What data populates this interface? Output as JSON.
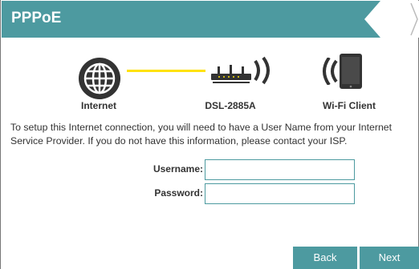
{
  "header": {
    "title": "PPPoE"
  },
  "diagram": {
    "internet_label": "Internet",
    "router_label": "DSL-2885A",
    "client_label": "Wi-Fi Client",
    "line_color": "#ffe20a"
  },
  "description": "To setup this Internet connection, you will need to have a User Name from your Internet Service Provider. If you do not have this information, please contact your ISP.",
  "form": {
    "username_label": "Username:",
    "username_value": "",
    "password_label": "Password:",
    "password_value": ""
  },
  "buttons": {
    "back": "Back",
    "next": "Next"
  },
  "colors": {
    "accent": "#4d9aa0",
    "text": "#333333"
  },
  "icons": [
    "globe-icon",
    "router-icon",
    "wifi-signal-icon",
    "tablet-icon"
  ]
}
